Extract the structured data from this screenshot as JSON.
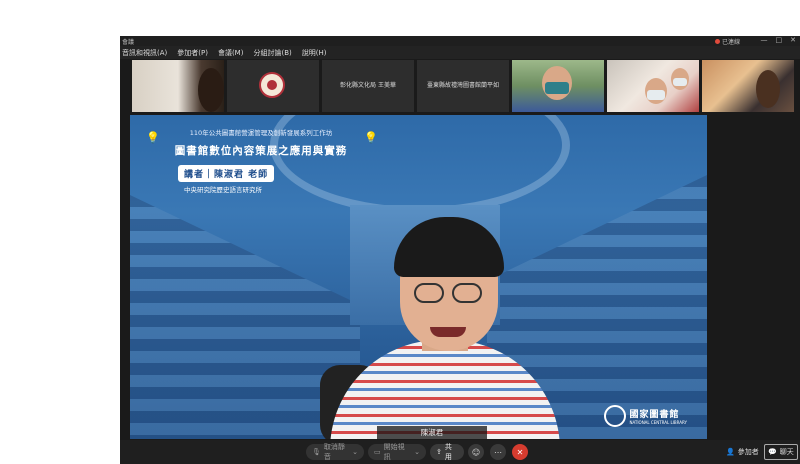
{
  "window": {
    "title": "會議",
    "connection_status": "已連線",
    "controls": [
      "—",
      "□",
      "✕"
    ]
  },
  "menubar": {
    "items": [
      "音訊和視訊(A)",
      "參加者(P)",
      "會議(M)",
      "分組討論(B)",
      "說明(H)"
    ]
  },
  "participant_strip": {
    "tiles": [
      {
        "type": "camera",
        "name": ""
      },
      {
        "type": "logo",
        "name": ""
      },
      {
        "type": "name",
        "name": "彰化縣文化局 王美華"
      },
      {
        "type": "name",
        "name": "臺東縣故禮灣圖書館蘭平如"
      },
      {
        "type": "camera",
        "name": ""
      },
      {
        "type": "camera",
        "name": ""
      },
      {
        "type": "camera",
        "name": ""
      }
    ]
  },
  "main_video": {
    "banner_subtitle": "110年公共圖書館營運管理及創新發展系列工作坊",
    "banner_title": "圖書館數位內容策展之應用與實務",
    "speaker_line": "講者｜陳淑君 老師",
    "speaker_org": "中央研究院歷史語言研究所",
    "library_name": "國家圖書館",
    "library_name_en": "NATIONAL CENTRAL LIBRARY",
    "speaker_label": "陳淑君"
  },
  "toolbar": {
    "mute_label": "取消靜音",
    "video_label": "開始視訊",
    "share_label": "共用",
    "participants_label": "參加者",
    "chat_label": "聊天"
  },
  "colors": {
    "accent_blue": "#2e6aa8",
    "leave_red": "#d63c2f",
    "status_red": "#e04b3c"
  }
}
